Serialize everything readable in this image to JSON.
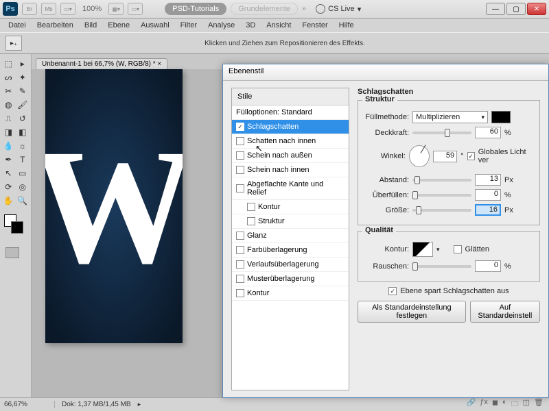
{
  "titlebar": {
    "logo": "Ps",
    "mini": [
      "Br",
      "Mb"
    ],
    "zoom": "100%",
    "workspace_active": "PSD-Tutorials",
    "workspace_dim": "Grundelemente",
    "cslive": "CS Live"
  },
  "menu": [
    "Datei",
    "Bearbeiten",
    "Bild",
    "Ebene",
    "Auswahl",
    "Filter",
    "Analyse",
    "3D",
    "Ansicht",
    "Fenster",
    "Hilfe"
  ],
  "options_hint": "Klicken und Ziehen zum Repositionieren des Effekts.",
  "doc_tab": "Unbenannt-1 bei 66,7% (W, RGB/8) *",
  "canvas_letter": "W",
  "status": {
    "zoom": "66,67%",
    "docsize": "Dok: 1,37 MB/1,45 MB"
  },
  "dialog": {
    "title": "Ebenenstil",
    "styles_header": "Stile",
    "fill_opts": "Fülloptionen: Standard",
    "styles": [
      {
        "label": "Schlagschatten",
        "checked": true,
        "selected": true
      },
      {
        "label": "Schatten nach innen",
        "checked": false
      },
      {
        "label": "Schein nach außen",
        "checked": false
      },
      {
        "label": "Schein nach innen",
        "checked": false
      },
      {
        "label": "Abgeflachte Kante und Relief",
        "checked": false
      },
      {
        "label": "Kontur",
        "checked": false,
        "indent": true
      },
      {
        "label": "Struktur",
        "checked": false,
        "indent": true
      },
      {
        "label": "Glanz",
        "checked": false
      },
      {
        "label": "Farbüberlagerung",
        "checked": false
      },
      {
        "label": "Verlaufsüberlagerung",
        "checked": false
      },
      {
        "label": "Musterüberlagerung",
        "checked": false
      },
      {
        "label": "Kontur",
        "checked": false
      }
    ],
    "section_title": "Schlagschatten",
    "struct_title": "Struktur",
    "blend_label": "Füllmethode:",
    "blend_value": "Multiplizieren",
    "opacity_label": "Deckkraft:",
    "opacity_value": "60",
    "angle_label": "Winkel:",
    "angle_value": "59",
    "angle_unit": "°",
    "global_light": "Globales Licht ver",
    "distance_label": "Abstand:",
    "distance_value": "13",
    "spread_label": "Überfüllen:",
    "spread_value": "0",
    "size_label": "Größe:",
    "size_value": "16",
    "px": "Px",
    "pct": "%",
    "quality_title": "Qualität",
    "contour_label": "Kontur:",
    "aa_label": "Glätten",
    "noise_label": "Rauschen:",
    "noise_value": "0",
    "knockout": "Ebene spart Schlagschatten aus",
    "btn_default": "Als Standardeinstellung festlegen",
    "btn_reset": "Auf Standardeinstell"
  }
}
